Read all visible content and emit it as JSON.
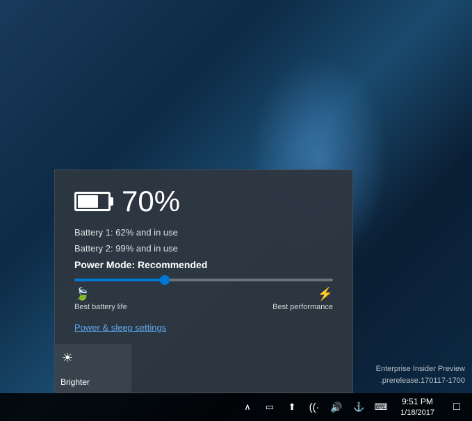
{
  "desktop": {
    "enterprise_line1": "Enterprise Insider Preview",
    "enterprise_line2": ".prerelease.170117-1700"
  },
  "battery_popup": {
    "percentage": "70%",
    "battery1": "Battery 1: 62% and in use",
    "battery2": "Battery 2: 99% and in use",
    "power_mode_label": "Power Mode: Recommended",
    "slider_fill_pct": 35,
    "label_left": "Best battery life",
    "label_right": "Best performance",
    "power_settings_link": "Power & sleep settings"
  },
  "quick_actions": [
    {
      "icon": "☀",
      "label": "Brighter"
    }
  ],
  "taskbar": {
    "chevron_label": "^",
    "tray_icons": [
      "□",
      "⬆",
      "((·",
      "🔊",
      "⚓",
      "⌨"
    ],
    "clock_time": "9:51 PM",
    "clock_date": "1/18/2017",
    "notification_icon": "□"
  }
}
